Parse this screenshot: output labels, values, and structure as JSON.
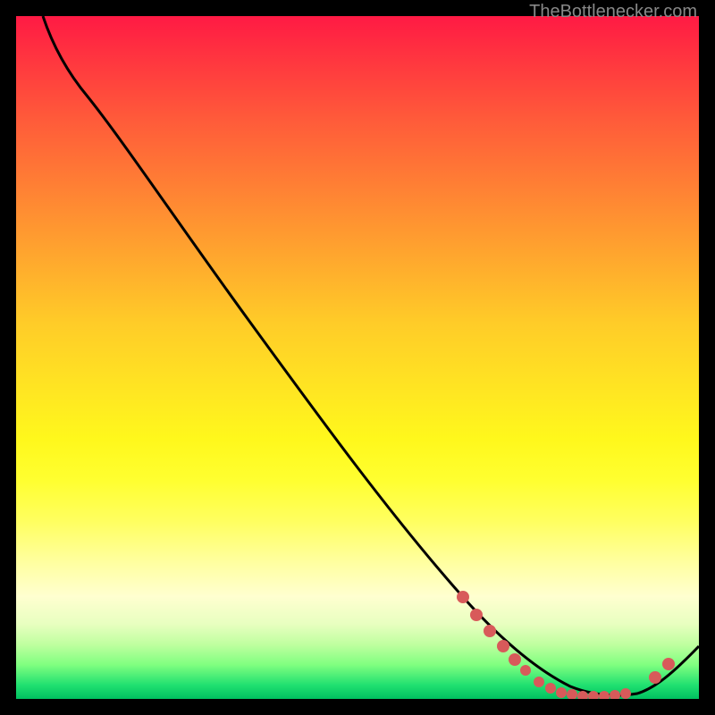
{
  "watermark": "TheBottlenecker.com",
  "chart_data": {
    "type": "line",
    "title": "",
    "xlabel": "",
    "ylabel": "",
    "xlim": [
      0,
      100
    ],
    "ylim": [
      0,
      100
    ],
    "background_gradient": [
      "#ff1a44",
      "#ffff30",
      "#00c060"
    ],
    "series": [
      {
        "name": "curve",
        "color": "#000000",
        "x": [
          4,
          8,
          12,
          18,
          25,
          32,
          40,
          48,
          56,
          62,
          68,
          72,
          76,
          80,
          84,
          88,
          92,
          96,
          100
        ],
        "y": [
          100,
          97,
          94,
          88,
          79,
          70,
          60,
          50,
          40,
          32,
          24,
          18,
          12,
          6,
          2,
          0,
          0,
          3,
          8
        ]
      }
    ],
    "markers": [
      {
        "x": 62,
        "y": 20,
        "color": "#d85a5a"
      },
      {
        "x": 64,
        "y": 16,
        "color": "#d85a5a"
      },
      {
        "x": 66,
        "y": 12,
        "color": "#d85a5a"
      },
      {
        "x": 68,
        "y": 8,
        "color": "#d85a5a"
      },
      {
        "x": 70,
        "y": 5,
        "color": "#d85a5a"
      },
      {
        "x": 72,
        "y": 3,
        "color": "#d85a5a"
      },
      {
        "x": 74,
        "y": 2,
        "color": "#d85a5a"
      },
      {
        "x": 76,
        "y": 1,
        "color": "#d85a5a"
      },
      {
        "x": 78,
        "y": 0.5,
        "color": "#d85a5a"
      },
      {
        "x": 80,
        "y": 0.5,
        "color": "#d85a5a"
      },
      {
        "x": 82,
        "y": 0.5,
        "color": "#d85a5a"
      },
      {
        "x": 84,
        "y": 0.5,
        "color": "#d85a5a"
      },
      {
        "x": 86,
        "y": 0.5,
        "color": "#d85a5a"
      },
      {
        "x": 88,
        "y": 0.5,
        "color": "#d85a5a"
      },
      {
        "x": 92,
        "y": 2,
        "color": "#d85a5a"
      },
      {
        "x": 94,
        "y": 4,
        "color": "#d85a5a"
      }
    ]
  }
}
